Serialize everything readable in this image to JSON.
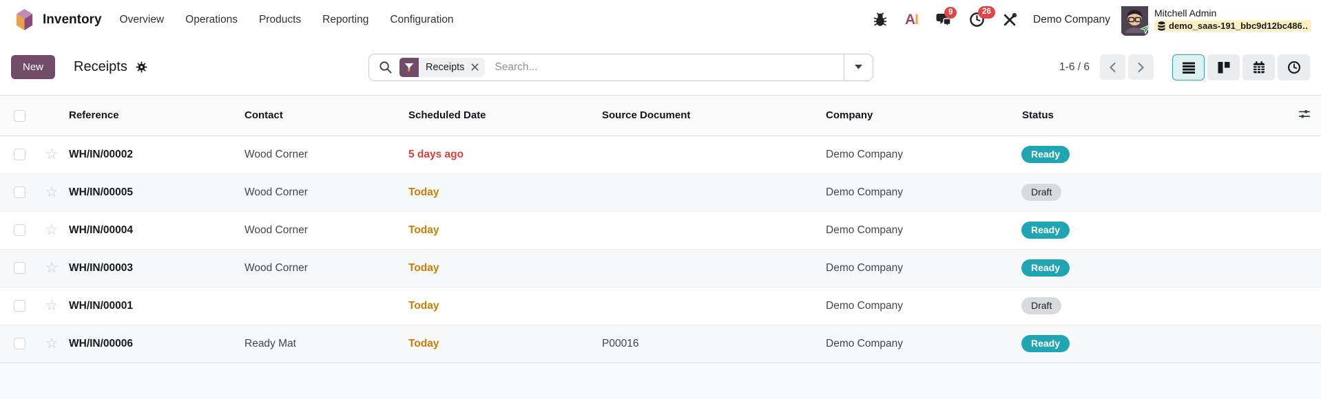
{
  "navbar": {
    "app_name": "Inventory",
    "menu": [
      {
        "label": "Overview"
      },
      {
        "label": "Operations"
      },
      {
        "label": "Products"
      },
      {
        "label": "Reporting"
      },
      {
        "label": "Configuration"
      }
    ],
    "systray": {
      "ai_logo": {
        "a": "A",
        "i": "I"
      },
      "message_badge": "9",
      "activity_badge": "26",
      "company_name": "Demo Company",
      "user_name": "Mitchell Admin",
      "database_name": "demo_saas-191_bbc9d12bc486…"
    }
  },
  "control_panel": {
    "new_button_label": "New",
    "title": "Receipts",
    "search": {
      "facet_label": "Receipts",
      "placeholder": "Search..."
    },
    "pager": {
      "range": "1-6 / 6"
    }
  },
  "table": {
    "columns": {
      "reference": "Reference",
      "contact": "Contact",
      "scheduled_date": "Scheduled Date",
      "source_document": "Source Document",
      "company": "Company",
      "status": "Status"
    },
    "rows": [
      {
        "reference": "WH/IN/00002",
        "contact": "Wood Corner",
        "scheduled_date": "5 days ago",
        "date_state": "late",
        "source_document": "",
        "company": "Demo Company",
        "status": "Ready",
        "status_variant": "ready"
      },
      {
        "reference": "WH/IN/00005",
        "contact": "Wood Corner",
        "scheduled_date": "Today",
        "date_state": "today",
        "source_document": "",
        "company": "Demo Company",
        "status": "Draft",
        "status_variant": "draft"
      },
      {
        "reference": "WH/IN/00004",
        "contact": "Wood Corner",
        "scheduled_date": "Today",
        "date_state": "today",
        "source_document": "",
        "company": "Demo Company",
        "status": "Ready",
        "status_variant": "ready"
      },
      {
        "reference": "WH/IN/00003",
        "contact": "Wood Corner",
        "scheduled_date": "Today",
        "date_state": "today",
        "source_document": "",
        "company": "Demo Company",
        "status": "Ready",
        "status_variant": "ready"
      },
      {
        "reference": "WH/IN/00001",
        "contact": "",
        "scheduled_date": "Today",
        "date_state": "today",
        "source_document": "",
        "company": "Demo Company",
        "status": "Draft",
        "status_variant": "draft"
      },
      {
        "reference": "WH/IN/00006",
        "contact": "Ready Mat",
        "scheduled_date": "Today",
        "date_state": "today",
        "source_document": "P00016",
        "company": "Demo Company",
        "status": "Ready",
        "status_variant": "ready"
      }
    ]
  },
  "colors": {
    "primary": "#714B67",
    "status_ready_bg": "#20a5b2",
    "status_draft_bg": "#d8dadd",
    "date_late": "#d4423c",
    "date_today": "#c77d06",
    "notification_badge": "#dc4747",
    "database_highlight": "#fcefc3"
  }
}
